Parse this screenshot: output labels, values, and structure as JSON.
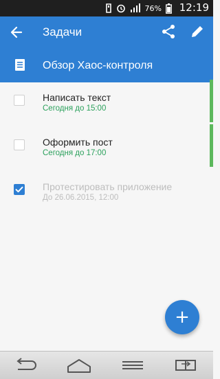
{
  "status_bar": {
    "battery_percent": "76%",
    "time": "12:19",
    "icons": [
      "sd-card-icon",
      "alarm-icon",
      "signal-icon",
      "battery-icon"
    ]
  },
  "app_bar": {
    "title": "Задачи",
    "back_icon": "arrow-back-icon",
    "share_icon": "share-icon",
    "edit_icon": "pencil-icon"
  },
  "project": {
    "name": "Обзор Хаос-контроля",
    "icon": "document-icon"
  },
  "tasks": [
    {
      "title": "Написать текст",
      "due": "Сегодня до 15:00",
      "done": false
    },
    {
      "title": "Оформить пост",
      "due": "Сегодня до 17:00",
      "done": false
    },
    {
      "title": "Протестировать приложение",
      "due": "До 26.06.2015, 12:00",
      "done": true
    }
  ],
  "fab": {
    "label": "+"
  },
  "nav_bar": {
    "icons": [
      "back-nav-icon",
      "home-nav-icon",
      "menu-nav-icon",
      "switch-app-icon"
    ]
  },
  "colors": {
    "primary": "#2e7fd3",
    "due_green": "#2aa05b",
    "completed_gray": "#bdbdbd",
    "marker_green": "#5cb85c"
  }
}
